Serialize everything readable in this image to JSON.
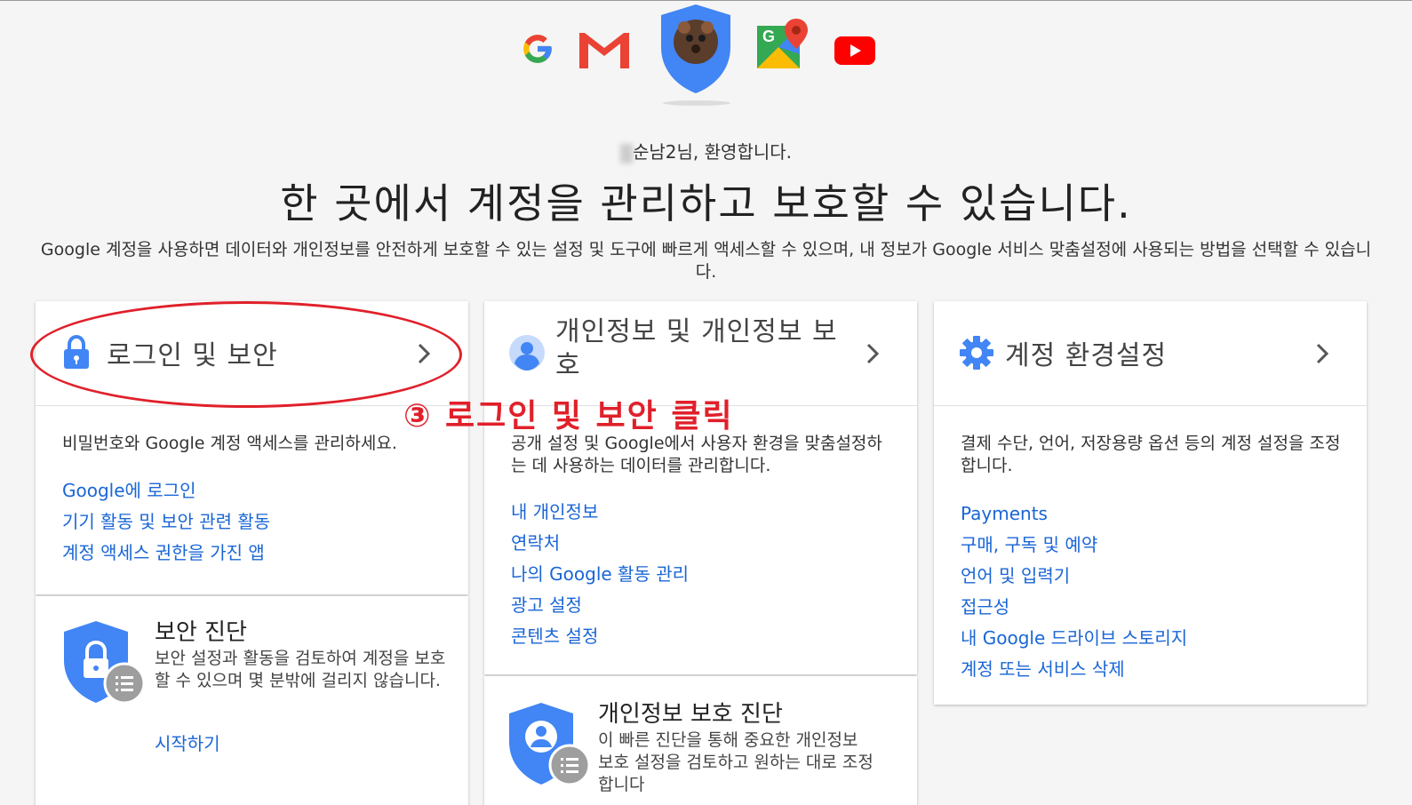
{
  "welcome": {
    "name_suffix": "순남2님, 환영합니다."
  },
  "headline": "한 곳에서 계정을 관리하고 보호할 수 있습니다.",
  "description": "Google 계정을 사용하면 데이터와 개인정보를 안전하게 보호할 수 있는 설정 및 도구에 빠르게 액세스할 수 있으며, 내 정보가 Google 서비스 맞춤설정에 사용되는 방법을 선택할 수 있습니다.",
  "annotation": "③ 로그인 및 보안 클릭",
  "colors": {
    "accent": "#4285f4",
    "link": "#1a66d6",
    "annotation": "#e0202a"
  },
  "cards": {
    "signin": {
      "title": "로그인 및 보안",
      "icon": "lock-icon",
      "body": "비밀번호와 Google 계정 액세스를 관리하세요.",
      "links": [
        "Google에 로그인",
        "기기 활동 및 보안 관련 활동",
        "계정 액세스 권한을 가진 앱"
      ],
      "checkup": {
        "title": "보안 진단",
        "text": "보안 설정과 활동을 검토하여 계정을 보호할 수 있으며 몇 분밖에 걸리지 않습니다.",
        "link": "시작하기"
      }
    },
    "privacy": {
      "title": "개인정보 및 개인정보 보호",
      "icon": "person-icon",
      "body": "공개 설정 및 Google에서 사용자 환경을 맞춤설정하는 데 사용하는 데이터를 관리합니다.",
      "links": [
        "내 개인정보",
        "연락처",
        "나의 Google 활동 관리",
        "광고 설정",
        "콘텐츠 설정"
      ],
      "checkup": {
        "title": "개인정보 보호 진단",
        "text": "이 빠른 진단을 통해 중요한 개인정보 보호 설정을 검토하고 원하는 대로 조정합니다"
      }
    },
    "prefs": {
      "title": "계정 환경설정",
      "icon": "gear-icon",
      "body": "결제 수단, 언어, 저장용량 옵션 등의 계정 설정을 조정합니다.",
      "links": [
        "Payments",
        "구매, 구독 및 예약",
        "언어 및 입력기",
        "접근성",
        "내 Google 드라이브 스토리지",
        "계정 또는 서비스 삭제"
      ]
    }
  }
}
